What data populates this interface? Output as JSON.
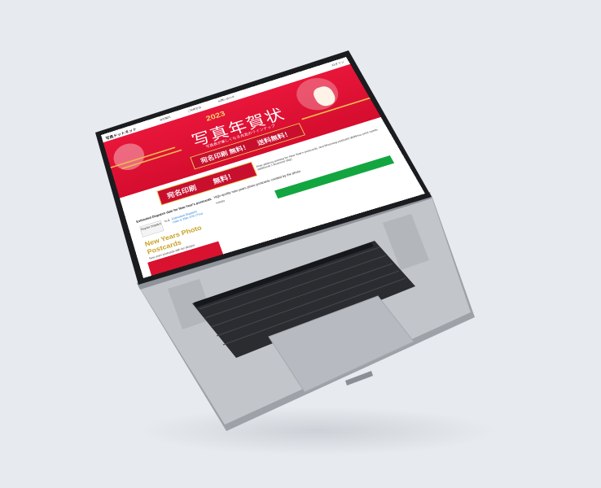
{
  "site": {
    "logo": "写真ドットネット",
    "login": "ログイン",
    "nav": [
      "会社案内",
      "ご利用方法",
      "お問い合わせ"
    ]
  },
  "banner": {
    "year": "2023",
    "title": "写真年賀状",
    "subtitle": "写真表が楽しくなる充実のラインナップ",
    "free_left": "宛名印刷 無料！",
    "free_right": "送料無料！"
  },
  "content": {
    "promo_left": "宛名印刷",
    "promo_right": "無料！",
    "promo_note": "Free address printing for New Year's postcards, and Mourning postcard (Address print needs additional 1 Business day)",
    "dispatch_title": "Estimated Dispatch date for New Year's postcards",
    "regular_btn": "Regular Dispatch",
    "to_label": "To &",
    "estimated": "Estimated Dispatch Date is 25th 27th (Thu)",
    "hq_title": "High-quality new years photo postcards created by the photo",
    "hq_sub": "hotlabs",
    "section_title": "New Years Photo Postcards",
    "section_sub": "New years postcards with fun designs"
  },
  "colors": {
    "background": "#e7eaee",
    "laptop_silver": "#b9bcc2",
    "banner_red": "#e8163a",
    "gold": "#f5c35a",
    "accent_green": "#13a640",
    "link_blue": "#1a7ad4"
  }
}
